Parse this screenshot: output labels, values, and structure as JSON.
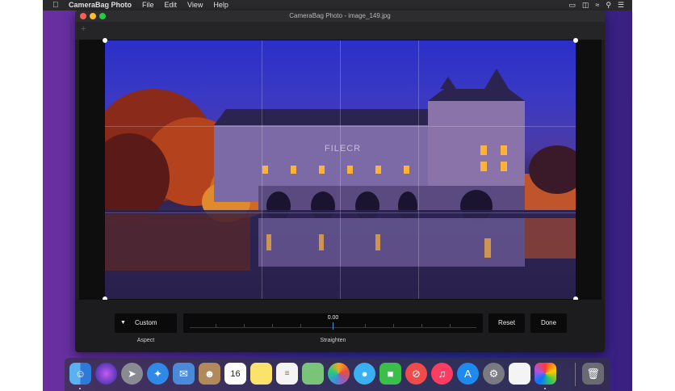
{
  "menubar": {
    "app_name": "CameraBag Photo",
    "items": [
      "File",
      "Edit",
      "View",
      "Help"
    ]
  },
  "window": {
    "title": "CameraBag Photo - image_149.jpg"
  },
  "crop": {
    "aspect_label": "Custom",
    "aspect_caption": "Aspect",
    "straighten_value": "0.00",
    "straighten_caption": "Straighten",
    "reset_label": "Reset",
    "done_label": "Done"
  },
  "photo": {
    "watermark": "FILECR"
  },
  "dock": {
    "apps": [
      "finder",
      "siri",
      "launchpad",
      "safari",
      "mail",
      "contacts",
      "calendar",
      "notes",
      "reminders",
      "maps",
      "photos",
      "messages",
      "facetime",
      "news",
      "music",
      "app-store",
      "system-preferences",
      "textedit",
      "camerabag",
      "trash"
    ]
  },
  "colors": {
    "accent": "#4a90e2",
    "window_bg": "#1e1e20",
    "button_bg": "#0a0a0b"
  }
}
